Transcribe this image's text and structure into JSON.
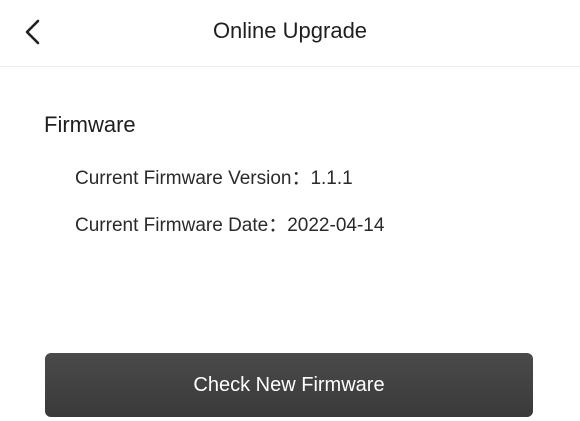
{
  "header": {
    "back_icon": "chevron-left-icon",
    "title": "Online Upgrade"
  },
  "firmware": {
    "section_title": "Firmware",
    "version_label": "Current Firmware Version：",
    "version_value": "1.1.1",
    "date_label": "Current Firmware Date：",
    "date_value": "2022-04-14"
  },
  "actions": {
    "check_label": "Check New Firmware"
  },
  "colors": {
    "button_bg": "#3f3f3f",
    "button_text": "#ffffff"
  }
}
